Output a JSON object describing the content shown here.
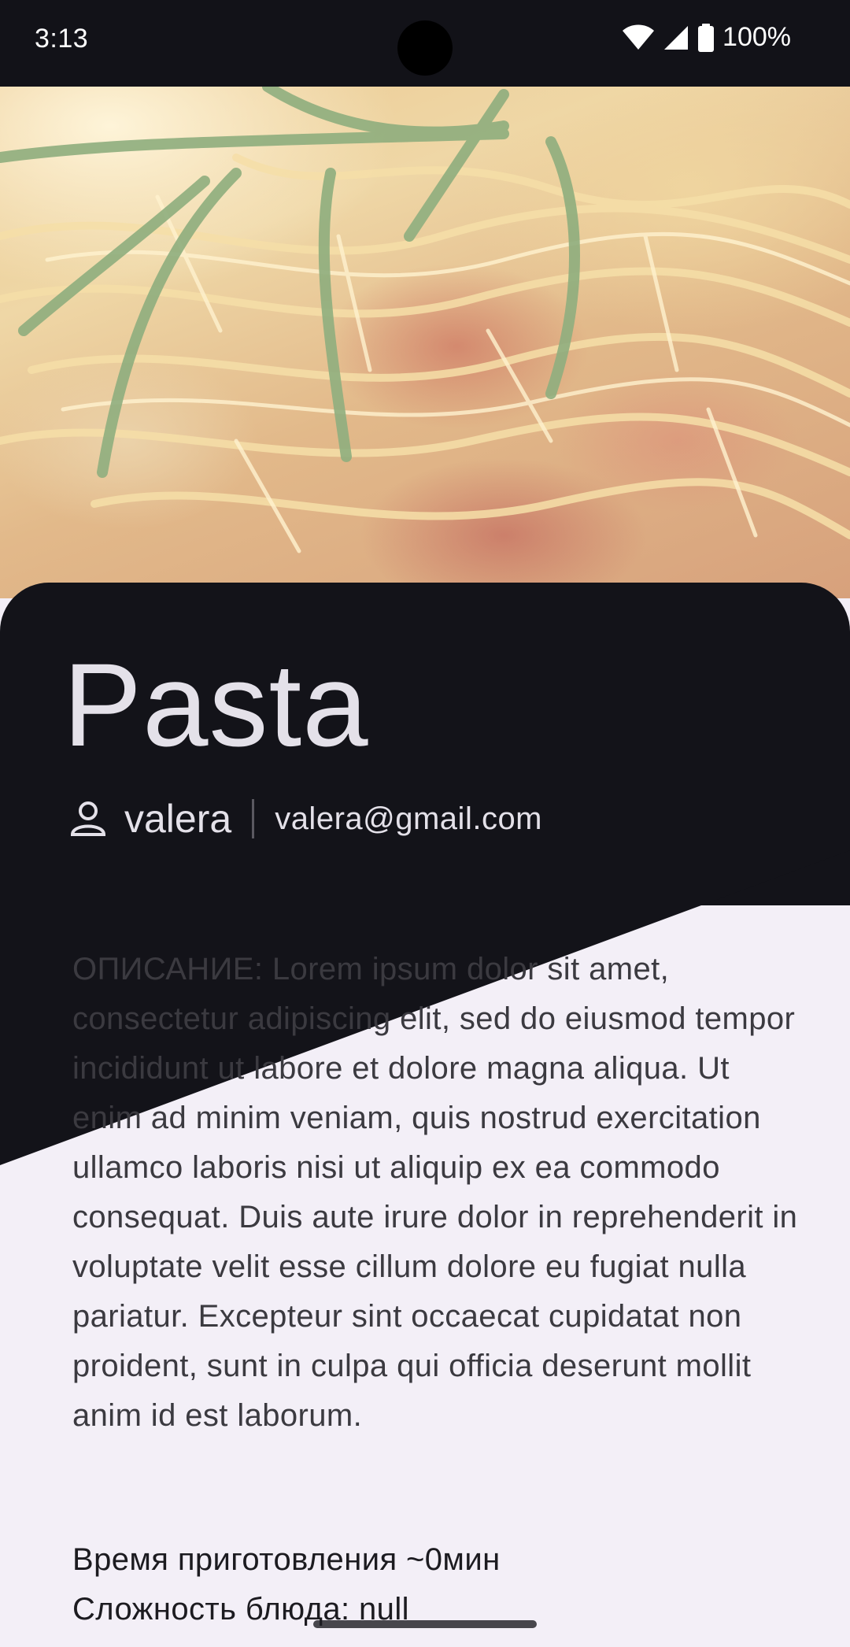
{
  "status_bar": {
    "time": "3:13",
    "battery": "100%",
    "icons": [
      "wifi-icon",
      "signal-icon",
      "battery-icon"
    ]
  },
  "hero": {
    "image": "pasta-photo"
  },
  "recipe": {
    "title": "Pasta",
    "author_name": "valera",
    "author_email": "valera@gmail.com",
    "description": "ОПИСАНИЕ: Lorem ipsum dolor sit amet, consectetur adipiscing elit, sed do eiusmod tempor incididunt ut labore et dolore magna aliqua. Ut enim ad minim veniam, quis nostrud exercitation ullamco laboris nisi ut aliquip ex ea commodo consequat. Duis aute irure dolor in reprehenderit in voluptate velit esse cillum dolore eu fugiat nulla pariatur. Excepteur sint occaecat cupidatat non proident, sunt in culpa qui officia deserunt mollit anim id est laborum.",
    "cook_time": "Время приготовления ~0мин",
    "difficulty": "Сложность блюда: null"
  },
  "colors": {
    "dark_panel": "#131319",
    "light_panel": "#f3eff7",
    "text_light": "#e4e1e9",
    "text_dark": "#1c1b20"
  }
}
